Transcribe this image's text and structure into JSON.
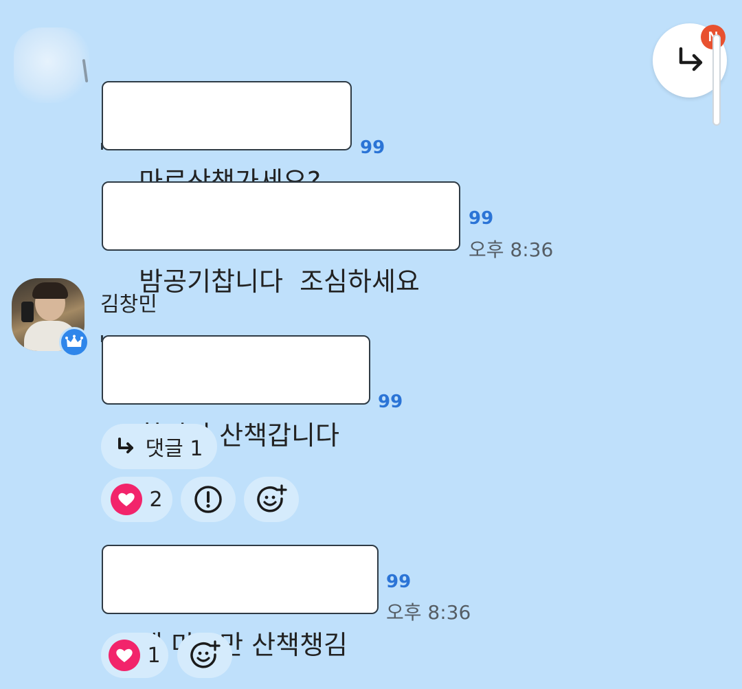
{
  "messages": [
    {
      "text": "마로산책가세요?",
      "count": "99"
    },
    {
      "text": "밤공기찹니다  조심하세요",
      "count": "99",
      "time": "오후 8:36"
    },
    {
      "text": "창민이 산책갑니다",
      "count": "99"
    },
    {
      "text": "왜 마로만 산책챙김",
      "count": "99",
      "time": "오후 8:36"
    }
  ],
  "sender": {
    "name": "김창민"
  },
  "reply": {
    "label": "댓글",
    "count": "1"
  },
  "reactions": [
    {
      "likes": "2"
    },
    {
      "likes": "1"
    }
  ],
  "fab": {
    "badge": "N",
    "icon": "reply-arrow-icon"
  },
  "colors": {
    "background": "#bfe0fb",
    "count": "#2b74d6",
    "heart": "#f2246b",
    "badge": "#e8512f"
  }
}
